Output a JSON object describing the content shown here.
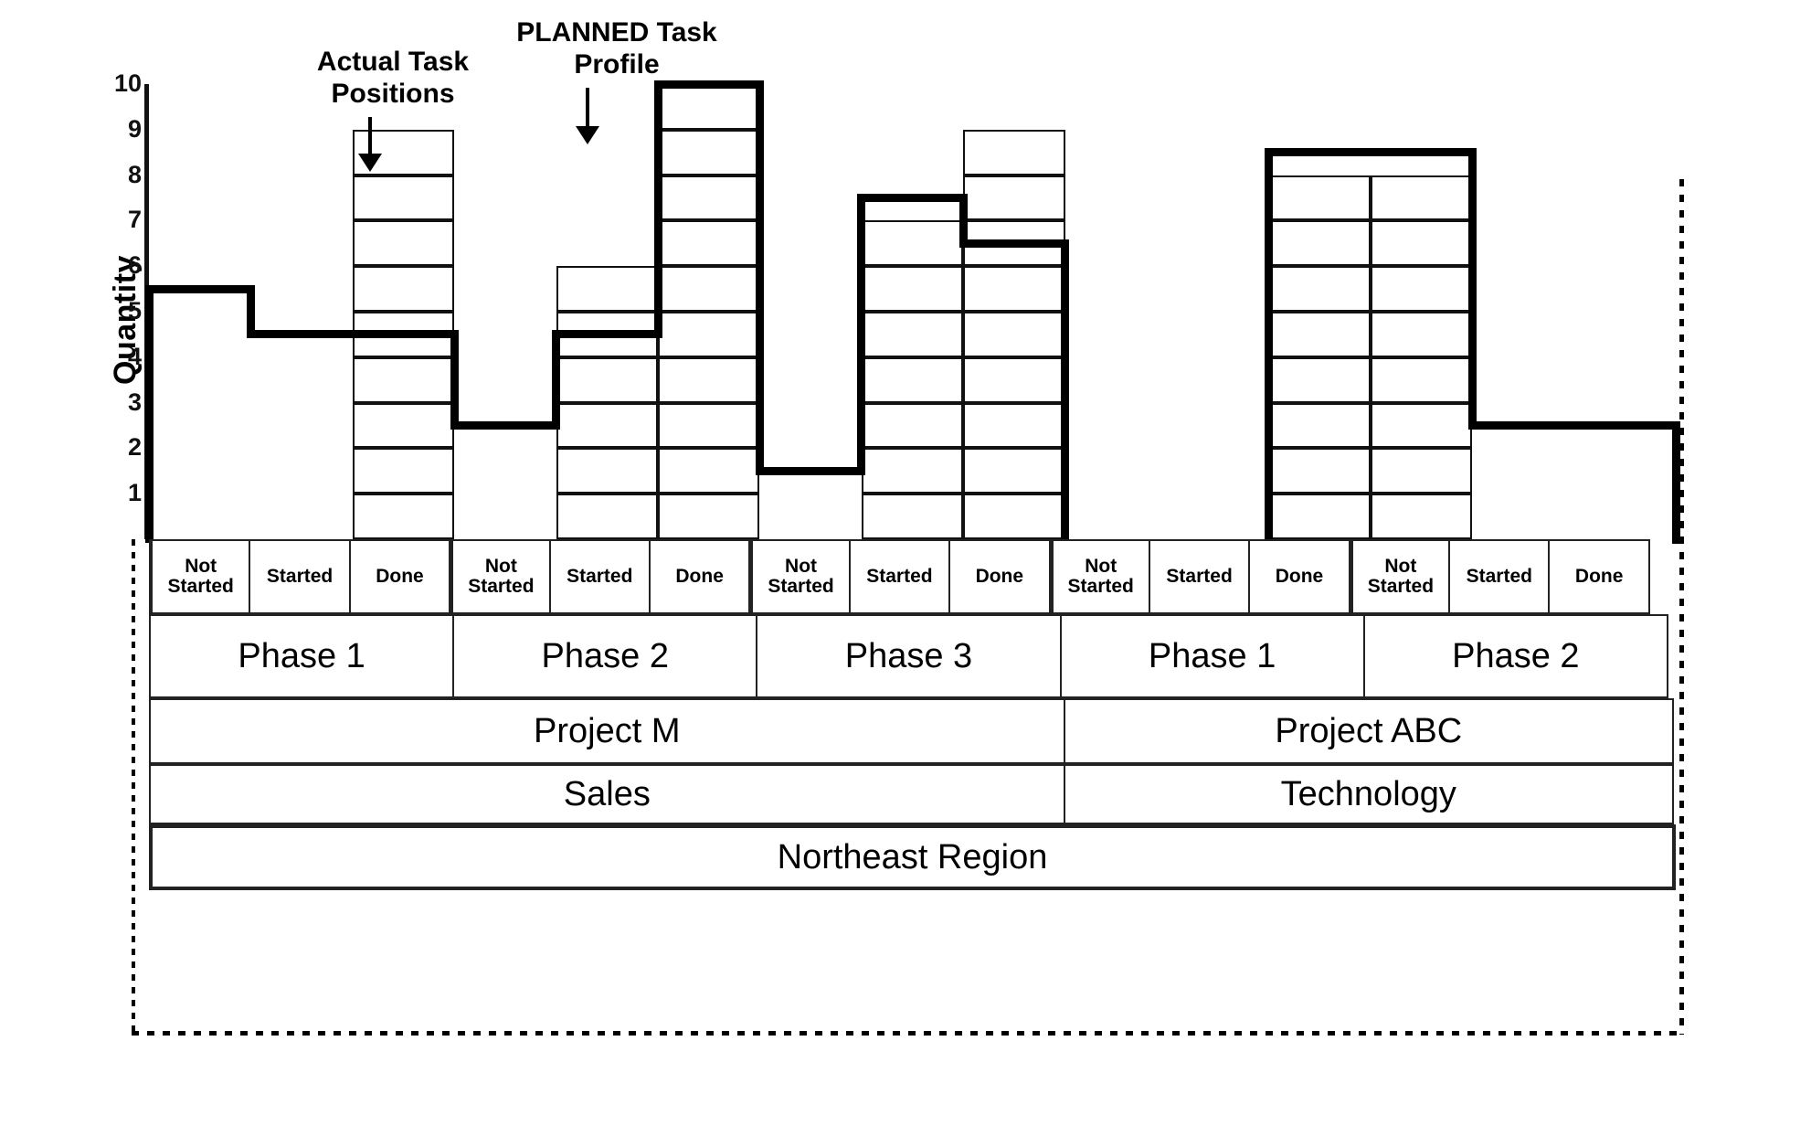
{
  "chart_data": {
    "type": "bar",
    "title": "",
    "xlabel": "",
    "ylabel": "Quantity",
    "ylim": [
      0,
      10.5
    ],
    "grid": false,
    "legend_position": "none",
    "y_ticks": [
      10,
      9,
      8,
      7,
      6,
      5,
      4,
      3,
      2,
      1
    ],
    "categories": [
      "Project M / Phase 1 / Not Started",
      "Project M / Phase 1 / Started",
      "Project M / Phase 1 / Done",
      "Project M / Phase 2 / Not Started",
      "Project M / Phase 2 / Started",
      "Project M / Phase 2 / Done",
      "Project M / Phase 3 / Not Started",
      "Project M / Phase 3 / Started",
      "Project M / Phase 3 / Done",
      "Project ABC / Phase 1 / Not Started",
      "Project ABC / Phase 1 / Started",
      "Project ABC / Phase 1 / Done",
      "Project ABC / Phase 2 / Not Started",
      "Project ABC / Phase 2 / Started",
      "Project ABC / Phase 2 / Done"
    ],
    "series": [
      {
        "name": "Actual Task Positions",
        "style": "stacked unit cells",
        "values": [
          0,
          0,
          9,
          0,
          6,
          10,
          0,
          7,
          9,
          0,
          0,
          8,
          8,
          0,
          0
        ]
      },
      {
        "name": "PLANNED Task Profile",
        "style": "bold step line",
        "values": [
          5.5,
          4.5,
          4.5,
          2.5,
          4.5,
          10,
          1.5,
          7.5,
          6.5,
          0,
          0,
          8.5,
          8.5,
          2.5,
          2.5
        ]
      }
    ],
    "annotations": [
      {
        "text": "Actual Task\nPositions",
        "points_to": "Project M / Phase 1 / Done"
      },
      {
        "text": "PLANNED Task\nProfile",
        "points_to": "Project M / Phase 2 / Done"
      }
    ]
  },
  "axis": {
    "y_title": "Quantity",
    "ticks": [
      "10",
      "9",
      "8",
      "7",
      "6",
      "5",
      "4",
      "3",
      "2",
      "1"
    ]
  },
  "annotations": {
    "actual": "Actual Task\nPositions",
    "planned": "PLANNED Task\nProfile"
  },
  "table": {
    "status_row": [
      "Not\nStarted",
      "Started",
      "Done",
      "Not\nStarted",
      "Started",
      "Done",
      "Not\nStarted",
      "Started",
      "Done",
      "Not\nStarted",
      "Started",
      "Done",
      "Not\nStarted",
      "Started",
      "Done"
    ],
    "phase_row": [
      {
        "label": "Phase 1",
        "span": 3
      },
      {
        "label": "Phase 2",
        "span": 3
      },
      {
        "label": "Phase 3",
        "span": 3
      },
      {
        "label": "Phase 1",
        "span": 3
      },
      {
        "label": "Phase 2",
        "span": 3
      }
    ],
    "project_row": [
      {
        "label": "Project M",
        "span": 9
      },
      {
        "label": "Project ABC",
        "span": 6
      }
    ],
    "department_row": [
      {
        "label": "Sales",
        "span": 9
      },
      {
        "label": "Technology",
        "span": 6
      }
    ],
    "region_row": [
      {
        "label": "Northeast Region",
        "span": 15
      }
    ]
  },
  "colors": {
    "ink": "#000000",
    "cell_border": "#111111",
    "background": "#ffffff"
  }
}
